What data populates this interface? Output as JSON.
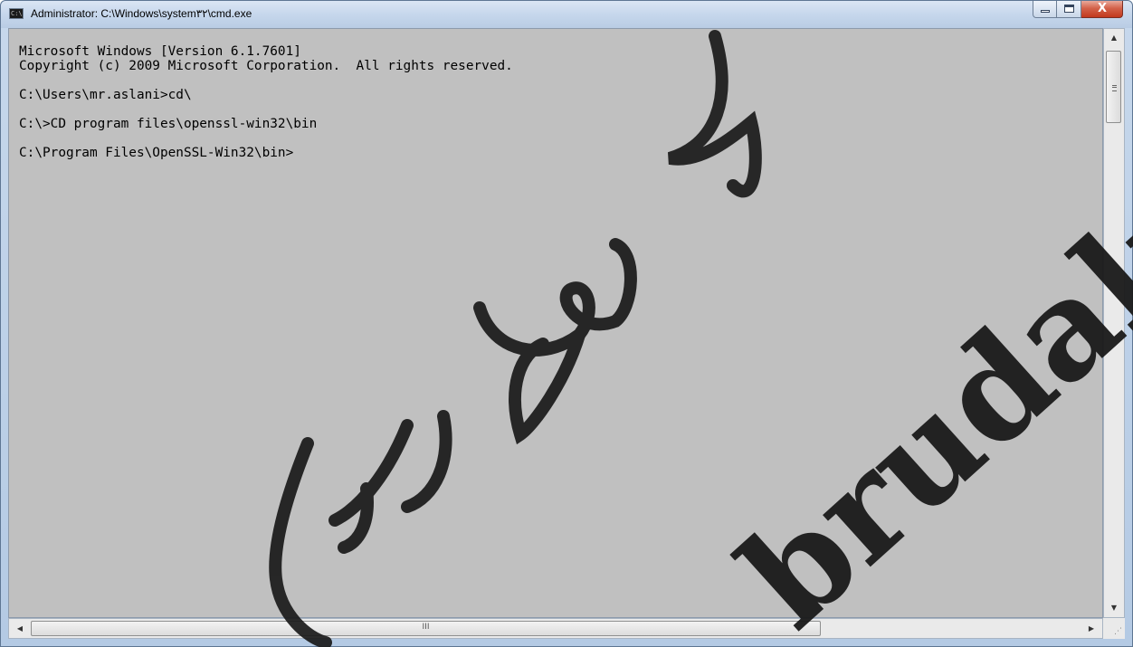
{
  "window": {
    "title": "Administrator: C:\\Windows\\system۳۲\\cmd.exe",
    "icon_label": "C:\\",
    "close_glyph": "X"
  },
  "console": {
    "lines": [
      "Microsoft Windows [Version 6.1.7601]",
      "Copyright (c) 2009 Microsoft Corporation.  All rights reserved.",
      "",
      "C:\\Users\\mr.aslani>cd\\",
      "",
      "C:\\>CD program files\\openssl-win32\\bin",
      "",
      "C:\\Program Files\\OpenSSL-Win32\\bin>"
    ],
    "background": "#c0c0c0",
    "foreground": "#000000"
  },
  "scrollbars": {
    "up_arrow": "▲",
    "down_arrow": "▼",
    "left_arrow": "◀",
    "right_arrow": "▶",
    "h_thumb_grip": "III",
    "resize_grip": "⋰"
  },
  "watermark": {
    "text_latin": "brudaki.ir",
    "color": "#1a1a1a"
  }
}
